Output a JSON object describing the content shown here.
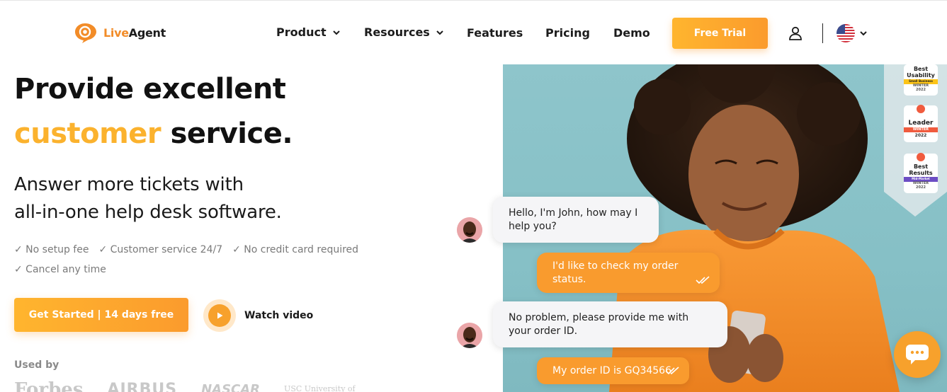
{
  "brand": {
    "name_part1": "Live",
    "name_part2": "Agent"
  },
  "nav": {
    "items": [
      {
        "label": "Product",
        "has_dropdown": true
      },
      {
        "label": "Resources",
        "has_dropdown": true
      },
      {
        "label": "Features",
        "has_dropdown": false
      },
      {
        "label": "Pricing",
        "has_dropdown": false
      },
      {
        "label": "Demo",
        "has_dropdown": false
      }
    ],
    "cta_label": "Free Trial",
    "user_icon": "user-icon",
    "language_icon": "us-flag-icon"
  },
  "hero": {
    "headline_line1": "Provide excellent",
    "headline_accent": "customer",
    "headline_rest": " service.",
    "subheadline_line1": "Answer more tickets with",
    "subheadline_line2": "all-in-one help desk software.",
    "checks": [
      "✓ No setup fee",
      "✓ Customer service 24/7",
      "✓ No credit card required",
      "✓ Cancel any time"
    ],
    "cta_label": "Get Started | 14 days free",
    "watch_label": "Watch video",
    "used_by_label": "Used by",
    "brands": [
      "Forbes",
      "AIRBUS",
      "NASCAR",
      "USC University of"
    ]
  },
  "awards": [
    {
      "line1": "Best",
      "line2": "Usability",
      "tag": "Small Business",
      "season": "WINTER",
      "year": "2022"
    },
    {
      "line1": "Leader",
      "line2": "",
      "tag": "WINTER",
      "season": "",
      "year": "2022"
    },
    {
      "line1": "Best",
      "line2": "Results",
      "tag": "Mid-Market",
      "season": "WINTER",
      "year": "2022"
    }
  ],
  "chat": {
    "messages": [
      {
        "from": "agent",
        "text": "Hello, I'm John, how may I help you?"
      },
      {
        "from": "client",
        "text": "I'd like to check my order status."
      },
      {
        "from": "agent",
        "text": "No problem, please provide me with your order ID."
      },
      {
        "from": "client",
        "text": "My order ID is GQ34566"
      }
    ]
  },
  "colors": {
    "accent": "#fbb22e",
    "button": "#fb9b2d",
    "photo_bg": "#8ec5cb"
  }
}
